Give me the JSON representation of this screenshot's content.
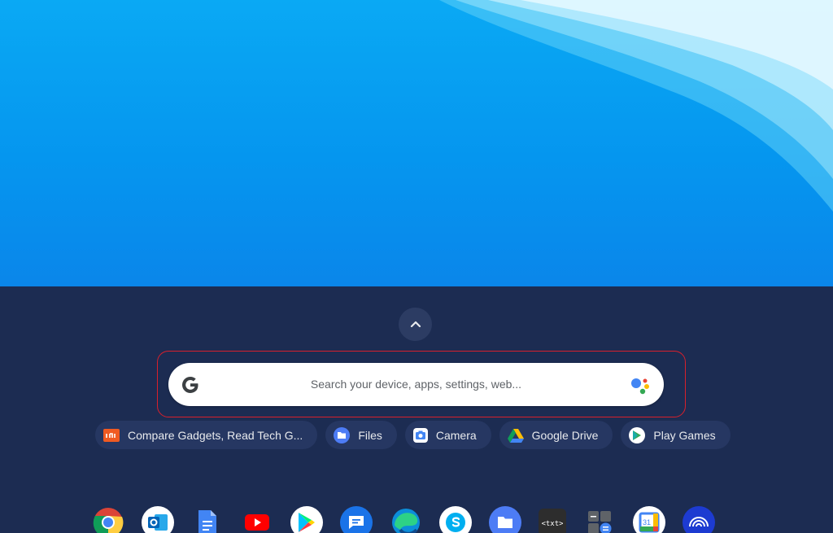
{
  "launcher": {
    "expand_icon": "chevron-up-icon",
    "search": {
      "placeholder": "Search your device, apps, settings, web...",
      "logo": "google-g-icon",
      "assistant_icon": "google-assistant-icon"
    },
    "suggestions": [
      {
        "label": "Compare Gadgets, Read Tech G...",
        "icon": "gadgets-site-icon"
      },
      {
        "label": "Files",
        "icon": "files-icon"
      },
      {
        "label": "Camera",
        "icon": "camera-icon"
      },
      {
        "label": "Google Drive",
        "icon": "google-drive-icon"
      },
      {
        "label": "Play Games",
        "icon": "play-games-icon"
      }
    ]
  },
  "shelf": {
    "apps": [
      "chrome-icon",
      "outlook-icon",
      "google-docs-icon",
      "youtube-icon",
      "play-store-icon",
      "messages-icon",
      "edge-icon",
      "skype-icon",
      "files-icon",
      "text-editor-icon",
      "calculator-icon",
      "google-calendar-icon",
      "wifi-app-icon"
    ]
  },
  "colors": {
    "wallpaper": "#0596ef",
    "launcher_bg": "#1c2c52",
    "chip_bg": "#263762",
    "highlight": "#d8202c"
  }
}
